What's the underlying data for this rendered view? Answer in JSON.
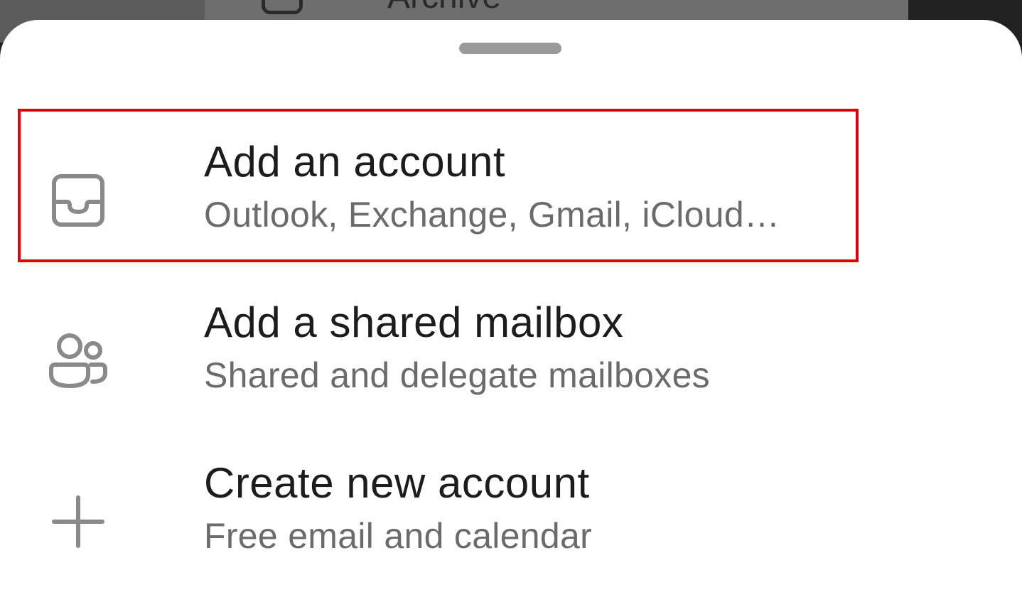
{
  "background": {
    "partial_label": "Archive"
  },
  "sheet": {
    "options": [
      {
        "title": "Add an account",
        "subtitle": "Outlook, Exchange, Gmail, iCloud…",
        "icon": "inbox-tray-icon"
      },
      {
        "title": "Add a shared mailbox",
        "subtitle": "Shared and delegate mailboxes",
        "icon": "people-icon"
      },
      {
        "title": "Create new account",
        "subtitle": "Free email and calendar",
        "icon": "plus-icon"
      }
    ]
  },
  "colors": {
    "highlight": "#e00000",
    "title_text": "#1c1c1c",
    "subtitle_text": "#6b6b6b",
    "icon_stroke": "#8a8a8a",
    "handle": "#9a9a9a"
  }
}
